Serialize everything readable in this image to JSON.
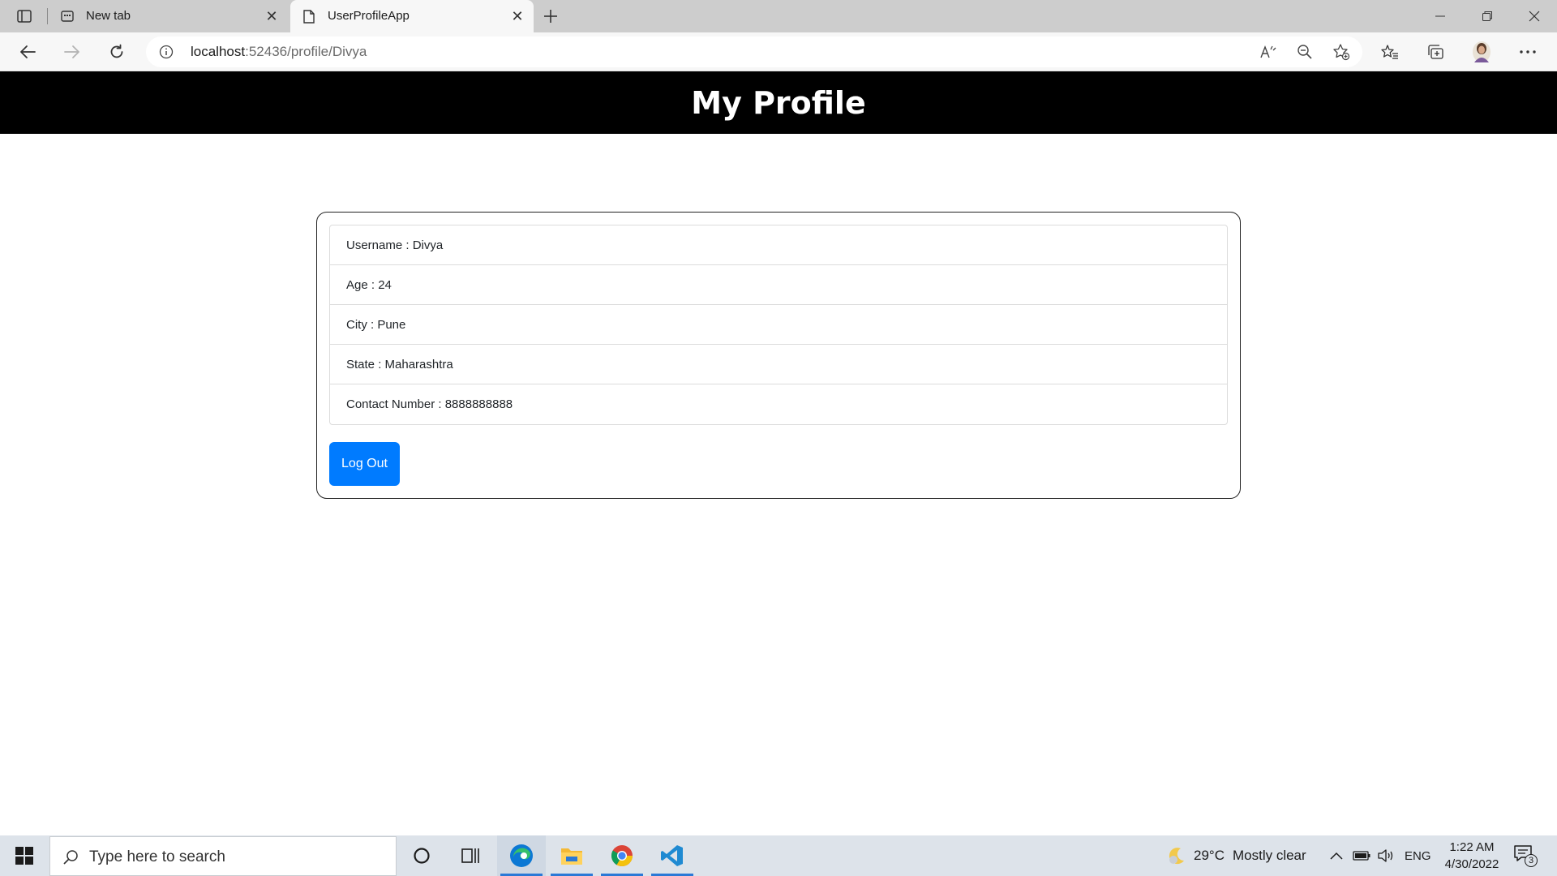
{
  "browser": {
    "tabs": [
      {
        "title": "New tab",
        "active": false
      },
      {
        "title": "UserProfileApp",
        "active": true
      }
    ],
    "address": {
      "host": "localhost",
      "path": ":52436/profile/Divya"
    },
    "icons": {
      "tab_actions": "tab-actions-icon",
      "new_tab": "plus-icon",
      "back": "back-arrow-icon",
      "forward": "forward-arrow-icon",
      "refresh": "refresh-icon",
      "info": "info-icon",
      "read_aloud": "read-aloud-icon",
      "zoom": "zoom-out-icon",
      "add_favorite": "add-favorite-icon",
      "favorites": "favorites-icon",
      "collections": "collections-icon",
      "profile": "avatar",
      "more": "more-icon"
    }
  },
  "page": {
    "header_title": "My Profile",
    "profile_items": [
      "Username : Divya",
      "Age : 24",
      "City : Pune",
      "State : Maharashtra",
      "Contact Number : 8888888888"
    ],
    "logout_label": "Log Out"
  },
  "taskbar": {
    "search_placeholder": "Type here to search",
    "weather": {
      "temp": "29°C",
      "condition": "Mostly clear"
    },
    "language": "ENG",
    "time": "1:22 AM",
    "date": "4/30/2022",
    "notification_count": "3"
  },
  "colors": {
    "header_bg": "#000000",
    "button_primary": "#007bff",
    "taskbar_bg": "#dde3ea",
    "tabstrip_bg": "#cdcdcd"
  }
}
